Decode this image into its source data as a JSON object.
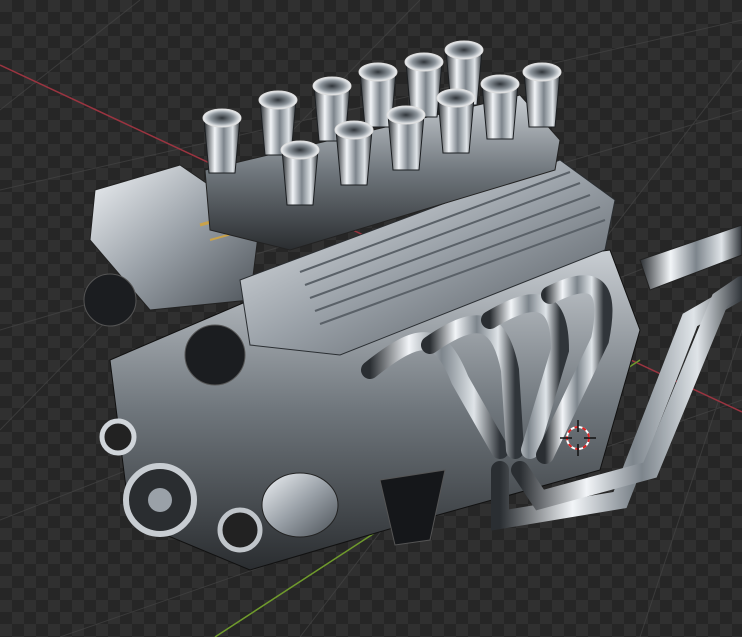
{
  "viewport": {
    "checker_dark": "#262626",
    "checker_light": "#303030",
    "grid_line_color": "#3d3d3d",
    "x_axis_color": "#9a3440",
    "y_axis_color": "#6f9a2c",
    "cursor_icon": "3d-cursor-icon"
  },
  "model": {
    "metal_light": "#e8ecf0",
    "metal_mid": "#8a929a",
    "metal_dark": "#1c1f22",
    "brass": "#c9a24a",
    "carburetor_trumpets": 12
  }
}
